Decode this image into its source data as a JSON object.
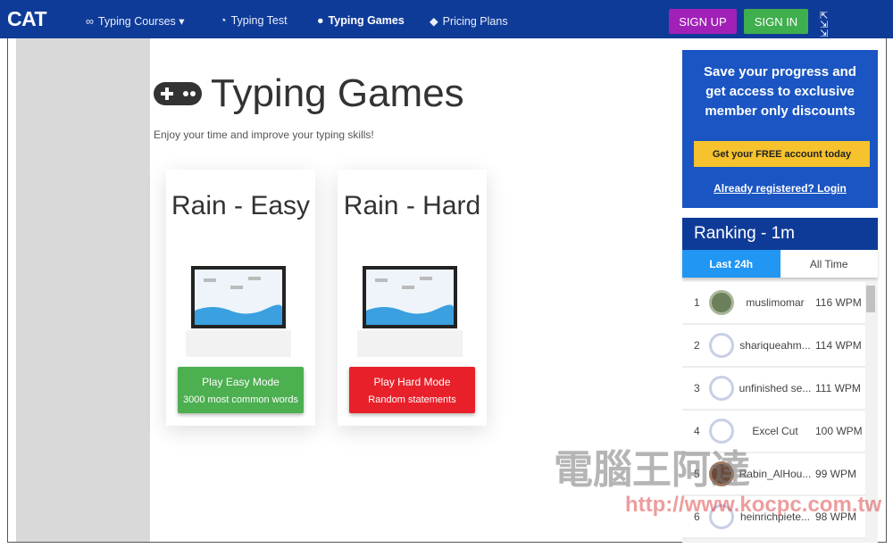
{
  "nav": {
    "logo": "CAT",
    "items": [
      {
        "label": "Typing Courses ▾",
        "icon": "glasses-icon"
      },
      {
        "label": "Typing Test",
        "icon": "dashboard-icon"
      },
      {
        "label": "Typing Games",
        "icon": "gamepad-icon"
      },
      {
        "label": "Pricing Plans",
        "icon": "tag-icon"
      }
    ],
    "sign_up": "SIGN UP",
    "sign_in": "SIGN IN"
  },
  "page": {
    "title": "Typing Games",
    "subtitle": "Enjoy your time and improve your typing skills!"
  },
  "games": [
    {
      "title": "Rain - Easy",
      "button": "Play Easy Mode",
      "desc": "3000 most common words",
      "color": "#4caf50"
    },
    {
      "title": "Rain - Hard",
      "button": "Play Hard Mode",
      "desc": "Random statements",
      "color": "#e8202a"
    }
  ],
  "promo": {
    "text": "Save your progress and get access to exclusive member only discounts",
    "cta": "Get your FREE account today",
    "login": "Already registered? Login"
  },
  "ranking": {
    "title": "Ranking - 1m",
    "tabs": [
      "Last 24h",
      "All Time"
    ],
    "rows": [
      {
        "rank": "1",
        "name": "muslimomar",
        "wpm": "116 WPM"
      },
      {
        "rank": "2",
        "name": "shariqueahm...",
        "wpm": "114 WPM"
      },
      {
        "rank": "3",
        "name": "unfinished se...",
        "wpm": "111 WPM"
      },
      {
        "rank": "4",
        "name": "Excel Cut",
        "wpm": "100 WPM"
      },
      {
        "rank": "5",
        "name": "Rabin_AlHou...",
        "wpm": "99 WPM"
      },
      {
        "rank": "6",
        "name": "heinrichpiete...",
        "wpm": "98 WPM"
      }
    ]
  },
  "watermark": {
    "text": "電腦王阿達",
    "url": "http://www.kocpc.com.tw"
  }
}
